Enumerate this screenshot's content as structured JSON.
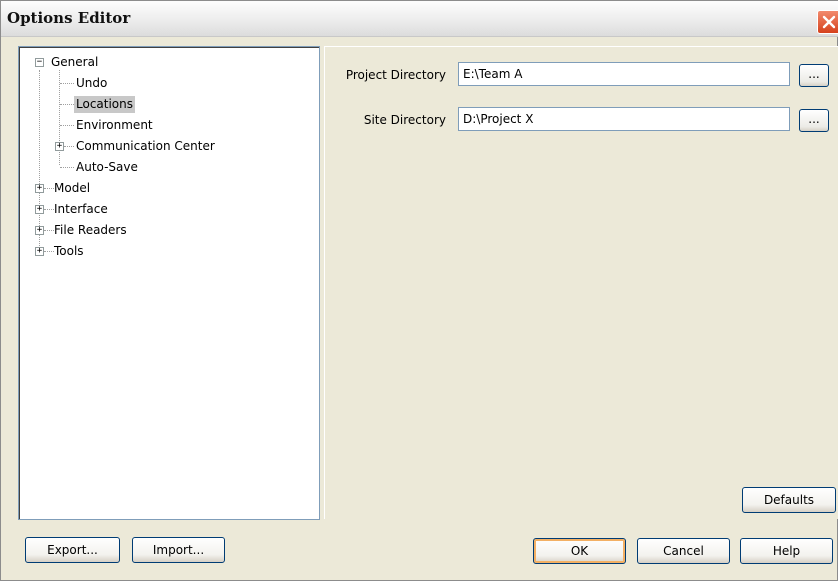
{
  "window": {
    "title": "Options Editor",
    "close_icon": "close-icon"
  },
  "tree": {
    "general": "General",
    "undo": "Undo",
    "locations": "Locations",
    "environment": "Environment",
    "communication_center": "Communication Center",
    "auto_save": "Auto-Save",
    "model": "Model",
    "interface": "Interface",
    "file_readers": "File Readers",
    "tools": "Tools",
    "selected": "Locations"
  },
  "locations": {
    "project_directory_label": "Project Directory",
    "project_directory_value": "E:\\Team A",
    "site_directory_label": "Site Directory",
    "site_directory_value": "D:\\Project X",
    "browse_label": "...",
    "defaults_label": "Defaults"
  },
  "footer": {
    "export_label": "Export...",
    "import_label": "Import...",
    "ok_label": "OK",
    "cancel_label": "Cancel",
    "help_label": "Help"
  },
  "colors": {
    "dialog_background": "#ece9d8",
    "selection_highlight": "#c8c8c8",
    "default_button_glow": "#f3b064",
    "close_button": "#d5411c"
  }
}
